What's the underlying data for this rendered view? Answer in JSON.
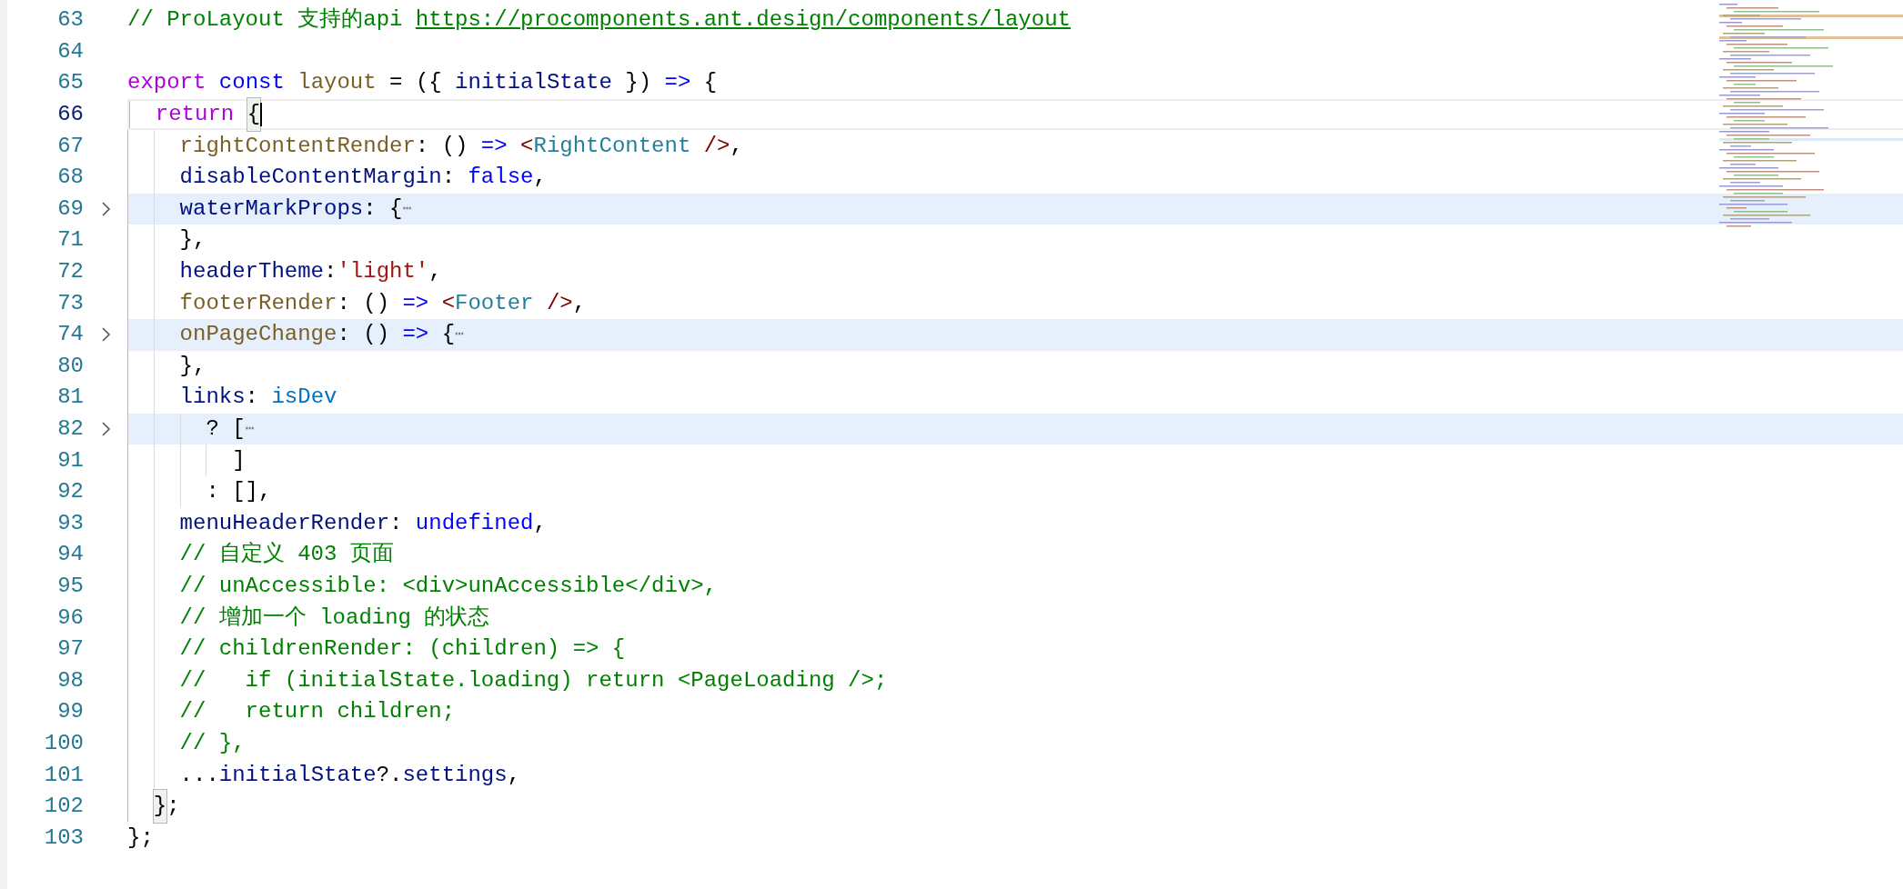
{
  "editor": {
    "lines": [
      {
        "number": "63",
        "tokens": [
          {
            "kind": "comment",
            "text": "// ProLayout 支持的api "
          },
          {
            "kind": "link",
            "text": "https://procomponents.ant.design/components/layout"
          }
        ]
      },
      {
        "number": "64"
      },
      {
        "number": "65",
        "tokens": [
          {
            "kind": "keyword",
            "text": "export "
          },
          {
            "kind": "storage",
            "text": "const "
          },
          {
            "kind": "function",
            "text": "layout"
          },
          {
            "kind": "plain",
            "text": " = ({ "
          },
          {
            "kind": "variable",
            "text": "initialState"
          },
          {
            "kind": "plain",
            "text": " }) "
          },
          {
            "kind": "storage",
            "text": "=>"
          },
          {
            "kind": "plain",
            "text": " {"
          }
        ]
      },
      {
        "number": "66",
        "current": true,
        "tokens": [
          {
            "kind": "keyword",
            "text": "  return "
          },
          {
            "kind": "plain",
            "text": "{",
            "matched": true
          }
        ]
      },
      {
        "number": "67",
        "tokens": [
          {
            "kind": "function",
            "text": "    rightContentRender"
          },
          {
            "kind": "plain",
            "text": ": () "
          },
          {
            "kind": "storage",
            "text": "=> "
          },
          {
            "kind": "tag",
            "text": "<"
          },
          {
            "kind": "component",
            "text": "RightContent "
          },
          {
            "kind": "tag",
            "text": "/>"
          },
          {
            "kind": "plain",
            "text": ","
          }
        ]
      },
      {
        "number": "68",
        "tokens": [
          {
            "kind": "variable",
            "text": "    disableContentMargin"
          },
          {
            "kind": "plain",
            "text": ": "
          },
          {
            "kind": "storage",
            "text": "false"
          },
          {
            "kind": "plain",
            "text": ","
          }
        ]
      },
      {
        "number": "69",
        "folded": true,
        "tokens": [
          {
            "kind": "variable",
            "text": "    waterMarkProps"
          },
          {
            "kind": "plain",
            "text": ": {"
          },
          {
            "kind": "ellipsis",
            "text": "⋯"
          }
        ]
      },
      {
        "number": "71",
        "tokens": [
          {
            "kind": "plain",
            "text": "    },"
          }
        ]
      },
      {
        "number": "72",
        "tokens": [
          {
            "kind": "variable",
            "text": "    headerTheme"
          },
          {
            "kind": "plain",
            "text": ":"
          },
          {
            "kind": "string",
            "text": "'light'"
          },
          {
            "kind": "plain",
            "text": ","
          }
        ]
      },
      {
        "number": "73",
        "tokens": [
          {
            "kind": "function",
            "text": "    footerRender"
          },
          {
            "kind": "plain",
            "text": ": () "
          },
          {
            "kind": "storage",
            "text": "=> "
          },
          {
            "kind": "tag",
            "text": "<"
          },
          {
            "kind": "component",
            "text": "Footer "
          },
          {
            "kind": "tag",
            "text": "/>"
          },
          {
            "kind": "plain",
            "text": ","
          }
        ]
      },
      {
        "number": "74",
        "folded": true,
        "tokens": [
          {
            "kind": "function",
            "text": "    onPageChange"
          },
          {
            "kind": "plain",
            "text": ": () "
          },
          {
            "kind": "storage",
            "text": "=>"
          },
          {
            "kind": "plain",
            "text": " {"
          },
          {
            "kind": "ellipsis",
            "text": "⋯"
          }
        ]
      },
      {
        "number": "80",
        "tokens": [
          {
            "kind": "plain",
            "text": "    },"
          }
        ]
      },
      {
        "number": "81",
        "tokens": [
          {
            "kind": "variable",
            "text": "    links"
          },
          {
            "kind": "plain",
            "text": ": "
          },
          {
            "kind": "constant",
            "text": "isDev"
          }
        ]
      },
      {
        "number": "82",
        "folded": true,
        "tokens": [
          {
            "kind": "plain",
            "text": "      ? ["
          },
          {
            "kind": "ellipsis",
            "text": "⋯"
          }
        ]
      },
      {
        "number": "91",
        "tokens": [
          {
            "kind": "plain",
            "text": "        ]"
          }
        ]
      },
      {
        "number": "92",
        "tokens": [
          {
            "kind": "plain",
            "text": "      : [],"
          }
        ]
      },
      {
        "number": "93",
        "tokens": [
          {
            "kind": "variable",
            "text": "    menuHeaderRender"
          },
          {
            "kind": "plain",
            "text": ": "
          },
          {
            "kind": "storage",
            "text": "undefined"
          },
          {
            "kind": "plain",
            "text": ","
          }
        ]
      },
      {
        "number": "94",
        "tokens": [
          {
            "kind": "comment",
            "text": "    // 自定义 403 页面"
          }
        ]
      },
      {
        "number": "95",
        "tokens": [
          {
            "kind": "comment",
            "text": "    // unAccessible: <div>unAccessible</div>,"
          }
        ]
      },
      {
        "number": "96",
        "tokens": [
          {
            "kind": "comment",
            "text": "    // 增加一个 loading 的状态"
          }
        ]
      },
      {
        "number": "97",
        "tokens": [
          {
            "kind": "comment",
            "text": "    // childrenRender: (children) => {"
          }
        ]
      },
      {
        "number": "98",
        "tokens": [
          {
            "kind": "comment",
            "text": "    //   if (initialState.loading) return <PageLoading />;"
          }
        ]
      },
      {
        "number": "99",
        "tokens": [
          {
            "kind": "comment",
            "text": "    //   return children;"
          }
        ]
      },
      {
        "number": "100",
        "tokens": [
          {
            "kind": "comment",
            "text": "    // },"
          }
        ]
      },
      {
        "number": "101",
        "tokens": [
          {
            "kind": "plain",
            "text": "    ..."
          },
          {
            "kind": "variable",
            "text": "initialState"
          },
          {
            "kind": "plain",
            "text": "?."
          },
          {
            "kind": "variable",
            "text": "settings"
          },
          {
            "kind": "plain",
            "text": ","
          }
        ]
      },
      {
        "number": "102",
        "tokens": [
          {
            "kind": "plain",
            "text": "  }",
            "matched": true
          },
          {
            "kind": "plain",
            "text": ";"
          }
        ]
      },
      {
        "number": "103",
        "tokens": [
          {
            "kind": "plain",
            "text": "};"
          }
        ]
      }
    ]
  }
}
